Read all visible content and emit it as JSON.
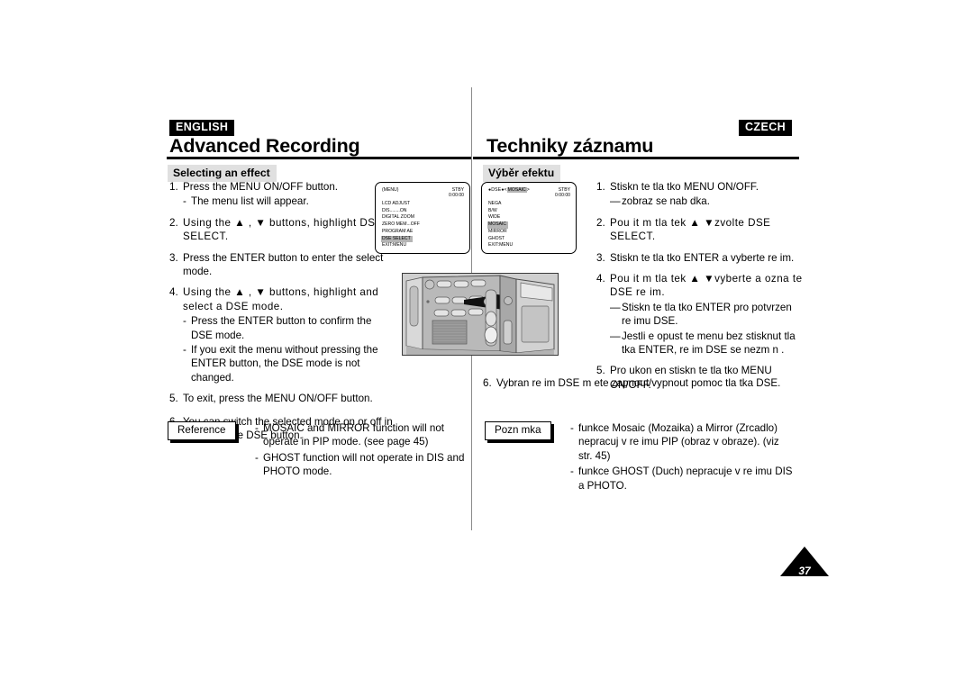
{
  "page": {
    "number": "37",
    "left_language_tag": "ENGLISH",
    "right_language_tag": "CZECH",
    "left_title": "Advanced Recording",
    "right_title": "Techniky záznamu",
    "left_subhead": "Selecting an effect",
    "right_subhead": "Výběr efektu"
  },
  "english": {
    "steps": [
      {
        "num": "1.",
        "text": "Press the MENU ON/OFF button.",
        "subs": [
          {
            "mark": "-",
            "text": "The menu list will appear."
          }
        ]
      },
      {
        "num": "2.",
        "text": "Using the ▲ , ▼ buttons, highlight DSE SELECT.",
        "subs": []
      },
      {
        "num": "3.",
        "text": "Press the ENTER button to enter the select mode.",
        "subs": []
      },
      {
        "num": "4.",
        "text": "Using the ▲ , ▼ buttons, highlight and select a DSE mode.",
        "subs": [
          {
            "mark": "-",
            "text": "Press the ENTER button to confirm the DSE mode."
          },
          {
            "mark": "-",
            "text": "If you exit the menu without pressing the ENTER button, the DSE mode is not changed."
          }
        ]
      },
      {
        "num": "5.",
        "text": "To exit, press the MENU ON/OFF button.",
        "subs": []
      },
      {
        "num": "6.",
        "text": "You can switch the selected mode on or off in DSE with the DSE button.",
        "subs": []
      }
    ],
    "reference_label": "Reference",
    "reference_notes": [
      {
        "mark": "-",
        "text": "MOSAIC and MIRROR function will not operate in PIP mode. (see page 45)"
      },
      {
        "mark": "-",
        "text": "GHOST function will not operate in DIS  and PHOTO mode."
      }
    ]
  },
  "czech": {
    "steps": [
      {
        "num": "1.",
        "text": "Stiskn te tla tko MENU ON/OFF.",
        "subs": [
          {
            "mark": "—",
            "text": "zobraz  se nab dka."
          }
        ]
      },
      {
        "num": "2.",
        "text": "Pou it m tla tek  ▲  ▼zvolte DSE SELECT.",
        "subs": []
      },
      {
        "num": "3.",
        "text": "Stiskn te tla tko ENTER a vyberte re im.",
        "subs": []
      },
      {
        "num": "4.",
        "text": "Pou it m tla tek  ▲  ▼vyberte a ozna te DSE re im.",
        "subs": [
          {
            "mark": "—",
            "text": "Stiskn te tla tko ENTER pro potvrzen  re imu DSE."
          },
          {
            "mark": "—",
            "text": "Jestli e opust te menu bez stisknut  tla tka ENTER, re im DSE se nezm n ."
          }
        ]
      },
      {
        "num": "5.",
        "text": "Pro ukon en  stiskn te tla tko MENU ON/OFF.",
        "subs": []
      },
      {
        "num": "6.",
        "text": "Vybran  re im DSE m ete zapnout/vypnout pomoc  tla tka DSE.",
        "subs": []
      }
    ],
    "reference_label": "Pozn mka",
    "reference_notes": [
      {
        "mark": "-",
        "text": "funkce Mosaic (Mozaika) a Mirror (Zrcadlo) nepracuj  v re imu PIP (obraz v obraze). (viz str. 45)"
      },
      {
        "mark": "-",
        "text": "funkce GHOST (Duch) nepracuje v re imu DIS a PHOTO."
      }
    ]
  },
  "lcd_menu": {
    "head_left": "(MENU)",
    "head_status": "STBY",
    "head_timecode": "0:00:00",
    "items": [
      {
        "label": "LCD  ADJUST",
        "highlighted": false
      },
      {
        "label": "DIS........ON",
        "highlighted": false
      },
      {
        "label": "DIGITAL  ZOOM",
        "highlighted": false
      },
      {
        "label": "ZERO  MEM...OFF",
        "highlighted": false
      },
      {
        "label": "PROGRAM  AE",
        "highlighted": false
      },
      {
        "label": "DSE  SELECT",
        "highlighted": true
      }
    ],
    "exit": "EXIT:MENU"
  },
  "lcd_dse": {
    "head_dse": "●DSE●",
    "head_mode_open": "<",
    "head_mode": "MOSAIC",
    "head_mode_close": ">",
    "head_status": "STBY",
    "head_timecode": "0:00:00",
    "items": [
      {
        "label": "NEGA",
        "highlighted": false
      },
      {
        "label": "B/W",
        "highlighted": false
      },
      {
        "label": "WIDE",
        "highlighted": false
      },
      {
        "label": "MOSAIC",
        "highlighted": true
      },
      {
        "label": "MIRROR",
        "highlighted": false
      },
      {
        "label": "GHOST",
        "highlighted": false
      }
    ],
    "exit": "EXIT:MENU"
  },
  "illustration": {
    "caption": "camcorder-rear-panel-buttons"
  },
  "colors": {
    "tag_bg": "#000000",
    "tag_fg": "#ffffff",
    "subhead_bg": "#e0e0e0",
    "highlight": "#b4b4b4",
    "rule": "#000000",
    "divider": "#8a8a8a"
  }
}
